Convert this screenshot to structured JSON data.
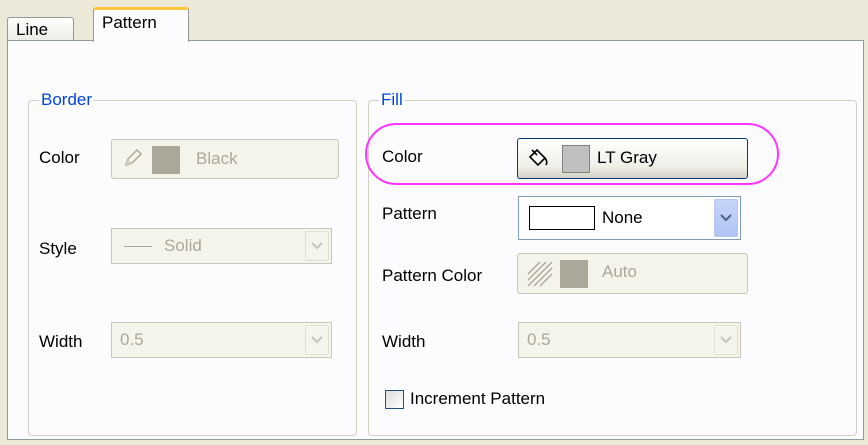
{
  "tabs": [
    {
      "label": "Line",
      "active": false
    },
    {
      "label": "Pattern",
      "active": true
    }
  ],
  "border": {
    "legend": "Border",
    "color": {
      "label": "Color",
      "value": "Black",
      "icon": "pencil-icon",
      "swatch_color": "#aca899"
    },
    "style": {
      "label": "Style",
      "value": "Solid"
    },
    "width": {
      "label": "Width",
      "value": "0.5"
    }
  },
  "fill": {
    "legend": "Fill",
    "color": {
      "label": "Color",
      "value": "LT Gray",
      "icon": "paint-bucket-icon",
      "swatch_color": "#c0c0c0"
    },
    "pattern": {
      "label": "Pattern",
      "value": "None"
    },
    "pattern_color": {
      "label": "Pattern Color",
      "value": "Auto",
      "icon": "hatch-icon",
      "swatch_color": "#aca899"
    },
    "width": {
      "label": "Width",
      "value": "0.5"
    },
    "increment_pattern": {
      "label": "Increment Pattern",
      "checked": false
    }
  },
  "colors": {
    "highlight": "#ff33ff",
    "legend": "#0046d5",
    "disabled_text": "#aca899"
  }
}
